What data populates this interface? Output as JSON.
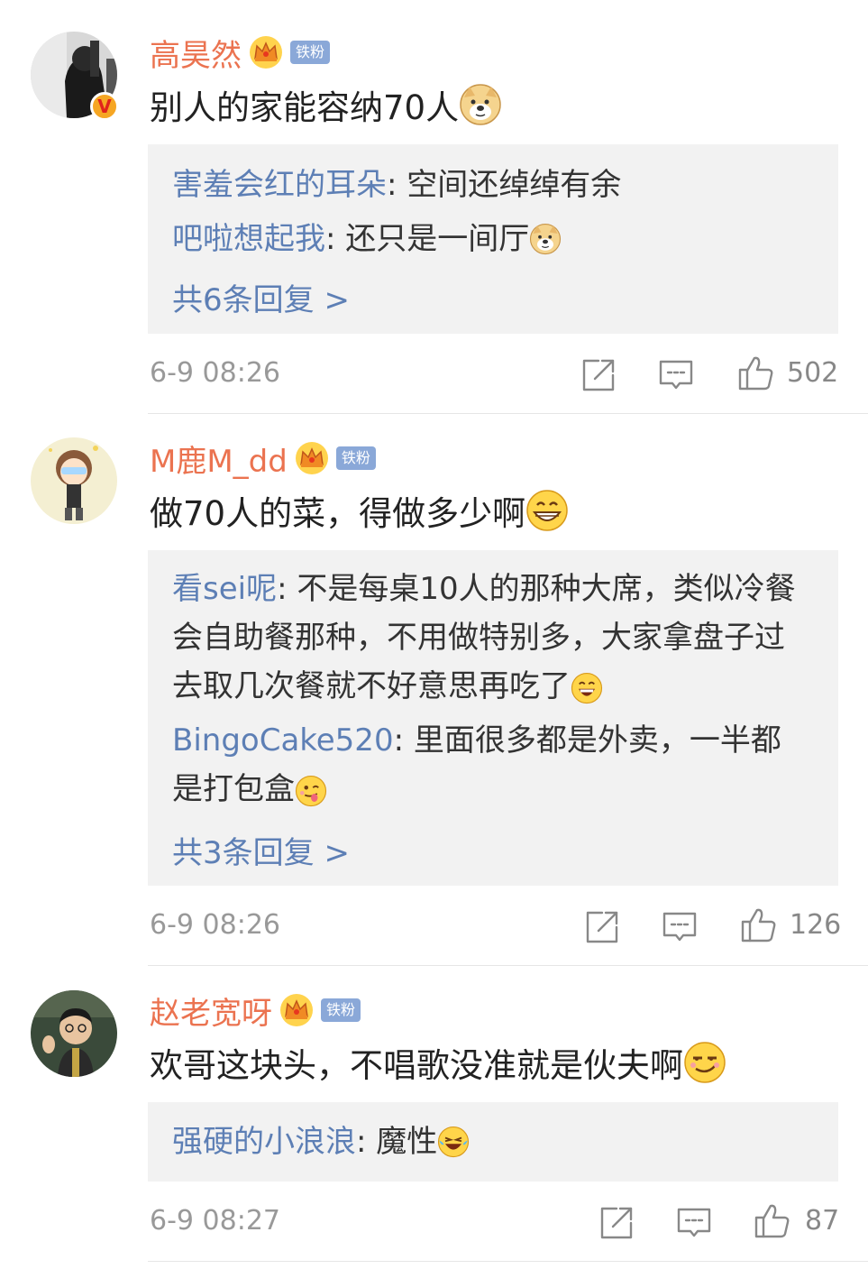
{
  "comments": [
    {
      "username": "高昊然",
      "fan_badge": "铁粉",
      "content": "别人的家能容纳70人",
      "replies": [
        {
          "name": "害羞会红的耳朵",
          "text": ": 空间还绰绰有余"
        },
        {
          "name": "吧啦想起我",
          "text": ": 还只是一间厅"
        }
      ],
      "reply_count": "共6条回复 >",
      "time": "6-9 08:26",
      "likes": "502"
    },
    {
      "username": "M鹿M_dd",
      "fan_badge": "铁粉",
      "content": "做70人的菜，得做多少啊",
      "replies": [
        {
          "name": "看sei呢",
          "text": ": 不是每桌10人的那种大席，类似冷餐会自助餐那种，不用做特别多，大家拿盘子过去取几次餐就不好意思再吃了"
        },
        {
          "name": "BingoCake520",
          "text": ": 里面很多都是外卖，一半都是打包盒"
        }
      ],
      "reply_count": "共3条回复 >",
      "time": "6-9 08:26",
      "likes": "126"
    },
    {
      "username": "赵老宽呀",
      "fan_badge": "铁粉",
      "content": "欢哥这块头，不唱歌没准就是伙夫啊",
      "replies": [
        {
          "name": "强硬的小浪浪",
          "text": ": 魔性"
        }
      ],
      "time": "6-9 08:27",
      "likes": "87"
    }
  ],
  "verified_badge": "V",
  "icons": {
    "share": "share-icon",
    "comment": "comment-icon",
    "like": "thumbs-up-icon",
    "crown": "crown-icon",
    "doge": "doge-emoji",
    "grin": "grin-emoji",
    "laugh": "laugh-emoji",
    "tongue": "tongue-emoji",
    "smirk": "smirk-emoji",
    "cry_laugh": "cry-laugh-emoji"
  },
  "colors": {
    "username": "#eb7350",
    "reply_name": "#5d7fb5",
    "reply_bg": "#f2f2f2",
    "fan_badge": "#8aa8d8",
    "meta": "#999999"
  }
}
